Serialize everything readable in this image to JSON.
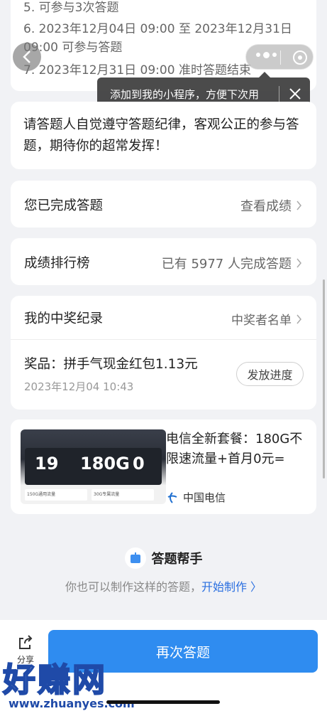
{
  "rules": {
    "line5": "5. 可参与3次答题",
    "line6a": "6. 2023年12月04日 09:00 至 2023年12月31日",
    "line6b": "09:00 可参与答题",
    "line7": "7. 2023年12月31日 09:00 准时答题结束"
  },
  "tooltip": {
    "text": "添加到我的小程序，方便下次用"
  },
  "notice": {
    "text": "请答题人自觉遵守答题纪律，客观公正的参与答题，期待你的超常发挥！"
  },
  "completed": {
    "label": "您已完成答题",
    "action": "查看成绩"
  },
  "ranking": {
    "label": "成绩排行榜",
    "summary": "已有 5977 人完成答题"
  },
  "prize": {
    "header": "我的中奖纪录",
    "winners_link": "中奖者名单",
    "name": "奖品：拼手气现金红包1.13元",
    "time": "2023年12月04 10:43",
    "progress_button": "发放进度"
  },
  "ad": {
    "text": "电信全新套餐：180G不限速流量+首月0元=",
    "brand": "中国电信",
    "img_price": "19",
    "img_data": "180G",
    "img_first": "0",
    "img_strip1": "150G通用流量",
    "img_strip2": "30G专属流量"
  },
  "helper": {
    "title": "答题帮手",
    "subtitle": "你也可以制作这样的答题，",
    "link": "开始制作 〉"
  },
  "bottom": {
    "share_label": "分享",
    "main_button": "再次答题"
  },
  "watermark": {
    "big": "好赚网",
    "url": "www.zhuanyes.com"
  },
  "colors": {
    "accent": "#2f8cf0",
    "link": "#2a6fe0",
    "background": "#f1f2f5"
  }
}
